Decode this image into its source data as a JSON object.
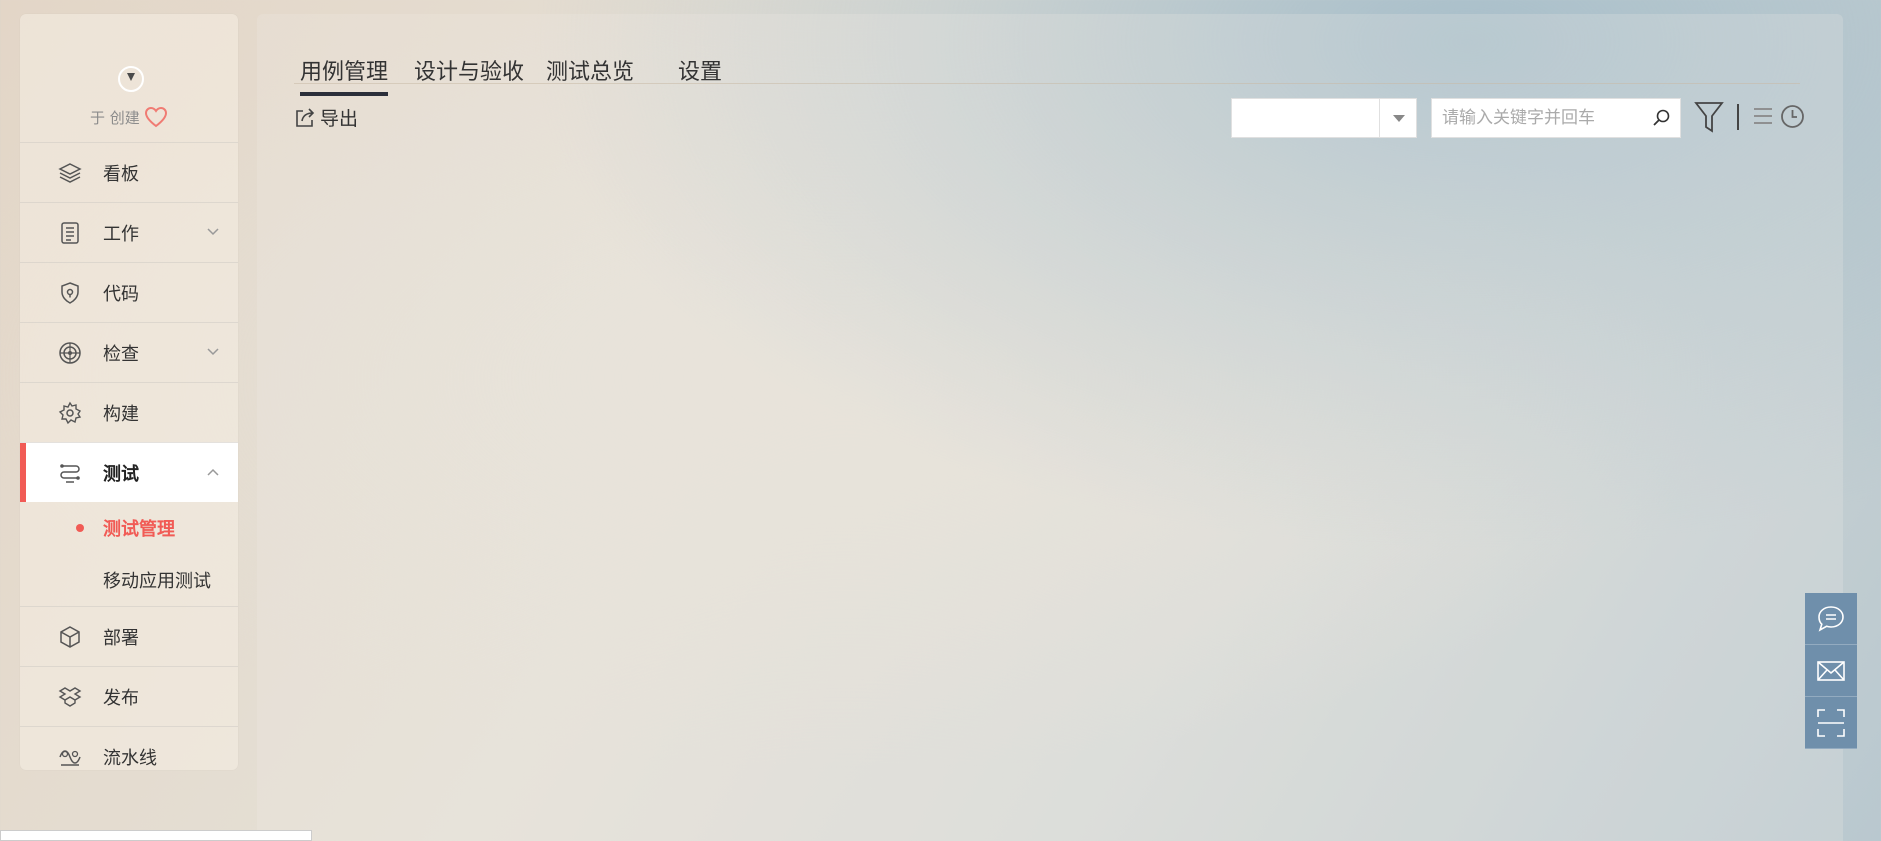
{
  "sidebar": {
    "creator_text": "于 创建",
    "items": [
      {
        "label": "看板",
        "icon": "layers-icon"
      },
      {
        "label": "工作",
        "icon": "document-list-icon"
      },
      {
        "label": "代码",
        "icon": "code-shield-icon"
      },
      {
        "label": "检查",
        "icon": "radar-icon"
      },
      {
        "label": "构建",
        "icon": "gear-icon"
      },
      {
        "label": "测试",
        "icon": "test-flow-icon"
      },
      {
        "label": "部署",
        "icon": "cube-icon"
      },
      {
        "label": "发布",
        "icon": "package-icon"
      },
      {
        "label": "流水线",
        "icon": "pipeline-icon"
      }
    ],
    "sub_items": [
      {
        "label": "测试管理"
      },
      {
        "label": "移动应用测试"
      }
    ]
  },
  "tabs": [
    {
      "label": "用例管理"
    },
    {
      "label": "设计与验收"
    },
    {
      "label": "测试总览"
    },
    {
      "label": "设置"
    }
  ],
  "toolbar": {
    "export_label": "导出",
    "select_value": "",
    "search_placeholder": "请输入关键字并回车"
  },
  "colors": {
    "accent": "#f15b55",
    "tab_underline": "#2b2f3a",
    "float_bar": "#6f8fab"
  }
}
